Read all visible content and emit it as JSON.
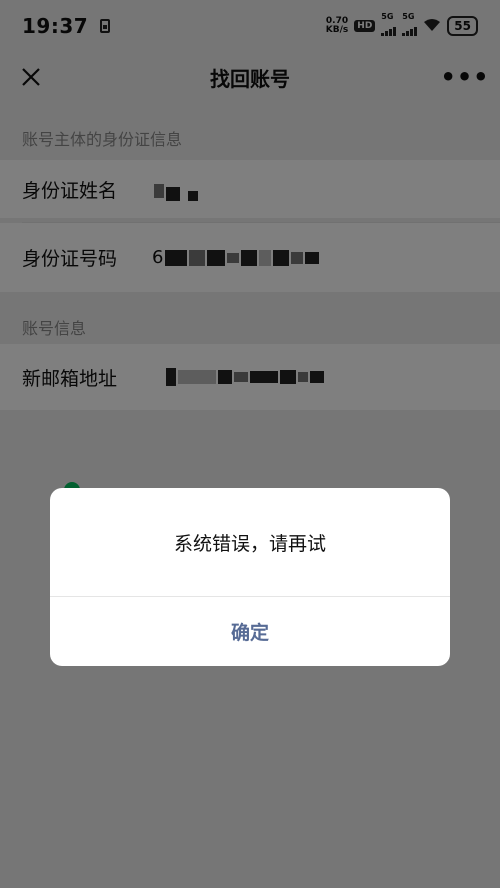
{
  "status_bar": {
    "time": "19:37",
    "net_speed_value": "0.70",
    "net_speed_unit": "KB/s",
    "hd_label": "HD",
    "signal1_label": "5G",
    "signal2_label": "5G",
    "battery": "55"
  },
  "nav": {
    "title": "找回账号",
    "close_icon": "close-icon",
    "more_icon": "more-icon",
    "more_glyph": "•••"
  },
  "sections": {
    "id_info_title": "账号主体的身份证信息",
    "account_info_title": "账号信息"
  },
  "fields": {
    "id_name_label": "身份证姓名",
    "id_number_label": "身份证号码",
    "id_number_prefix": "6",
    "email_label": "新邮箱地址"
  },
  "dialog": {
    "message": "系统错误，请再试",
    "confirm_label": "确定"
  },
  "colors": {
    "accent_link": "#576b95",
    "check_green": "#07c160",
    "background": "#ededed"
  }
}
